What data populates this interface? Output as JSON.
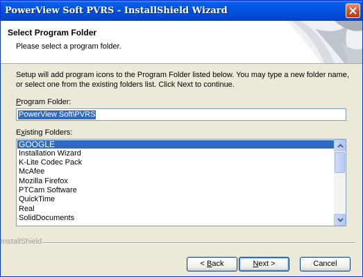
{
  "window": {
    "title": "PowerView Soft PVRS - InstallShield Wizard",
    "close_icon": "close-icon"
  },
  "header": {
    "title": "Select Program Folder",
    "subtitle": "Please select a program folder."
  },
  "body": {
    "instructions": "Setup will add program icons to the Program Folder listed below.  You may type a new folder name, or select one from the existing folders list.  Click Next to continue."
  },
  "program_folder": {
    "label_hotkey": "P",
    "label_rest": "rogram Folder:",
    "value": "PowerView Soft\\PVRS"
  },
  "existing_folders": {
    "label_first": "E",
    "label_hotkey": "x",
    "label_rest": "isting Folders:",
    "items": [
      "GOOGLE",
      "Installation Wizard",
      "K-Lite Codec Pack",
      "McAfee",
      "Mozilla Firefox",
      "PTCam Software",
      "QuickTime",
      "Real",
      "SolidDocuments"
    ],
    "selected_index": 0
  },
  "footer": {
    "brand": "InstallShield"
  },
  "buttons": {
    "back_pre": "< ",
    "back_hotkey": "B",
    "back_rest": "ack",
    "next_hotkey": "N",
    "next_rest": "ext >",
    "cancel": "Cancel"
  },
  "colors": {
    "titlebar": "#0054e3",
    "selection": "#316ac5",
    "face": "#ece9d8"
  }
}
